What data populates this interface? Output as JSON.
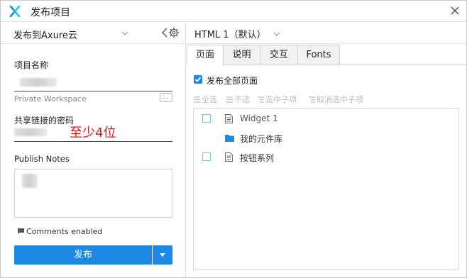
{
  "window": {
    "title": "发布项目"
  },
  "left": {
    "target": "发布到Axure云",
    "project_name_label": "项目名称",
    "project_name_value": "",
    "workspace": "Private Workspace",
    "more_label": "...",
    "share_password_label": "共享链接的密码",
    "password_annotation": "至少4位",
    "publish_notes_label": "Publish Notes",
    "comments_label": "Comments enabled",
    "publish_button": "发布"
  },
  "right": {
    "format": "HTML 1（默认）",
    "tabs": [
      "页面",
      "说明",
      "交互",
      "Fonts"
    ],
    "active_tab": "页面",
    "publish_all_label": "发布全部页面",
    "publish_all_checked": true,
    "toolbar": [
      "全选",
      "不选",
      "选中子项",
      "取消选中子项"
    ],
    "tree": [
      {
        "type": "page",
        "label": "Widget 1",
        "checkbox": true
      },
      {
        "type": "folder",
        "label": "我的元件库",
        "checkbox": false
      },
      {
        "type": "page",
        "label": "按钮系列",
        "checkbox": true
      }
    ]
  },
  "colors": {
    "accent": "#1e88e5",
    "warning": "#e01414"
  }
}
